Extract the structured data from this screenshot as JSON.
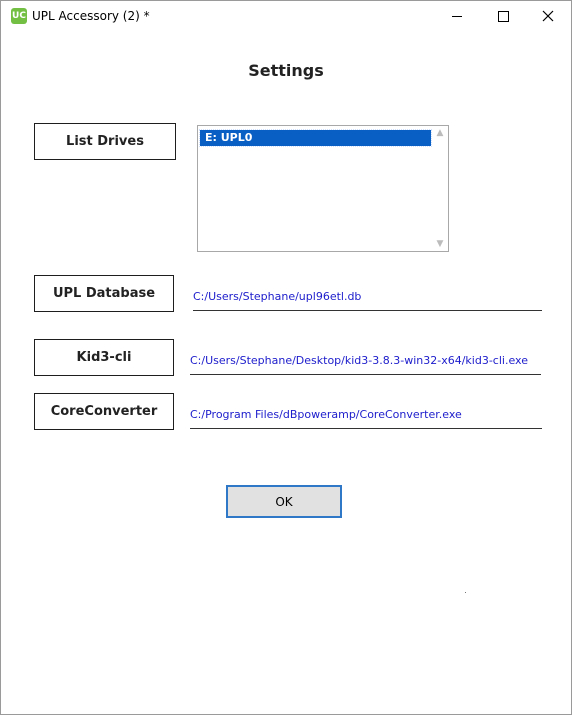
{
  "window": {
    "title": "UPL Accessory (2) *",
    "app_icon_text": "UC"
  },
  "heading": "Settings",
  "list_drives": {
    "button_label": "List Drives",
    "items": [
      "E: UPL0"
    ],
    "selected_index": 0
  },
  "upl_database": {
    "button_label": "UPL Database",
    "path": "C:/Users/Stephane/upl96etl.db"
  },
  "kid3": {
    "button_label": "Kid3-cli",
    "path": "C:/Users/Stephane/Desktop/kid3-3.8.3-win32-x64/kid3-cli.exe"
  },
  "coreconverter": {
    "button_label": "CoreConverter",
    "path": "C:/Program Files/dBpoweramp/CoreConverter.exe"
  },
  "ok_label": "OK",
  "colors": {
    "selection": "#0a5fc4",
    "path_text": "#1c1ccc",
    "ok_border": "#2f78c8",
    "ok_fill": "#e1e1e1",
    "app_icon": "#72bf44"
  }
}
